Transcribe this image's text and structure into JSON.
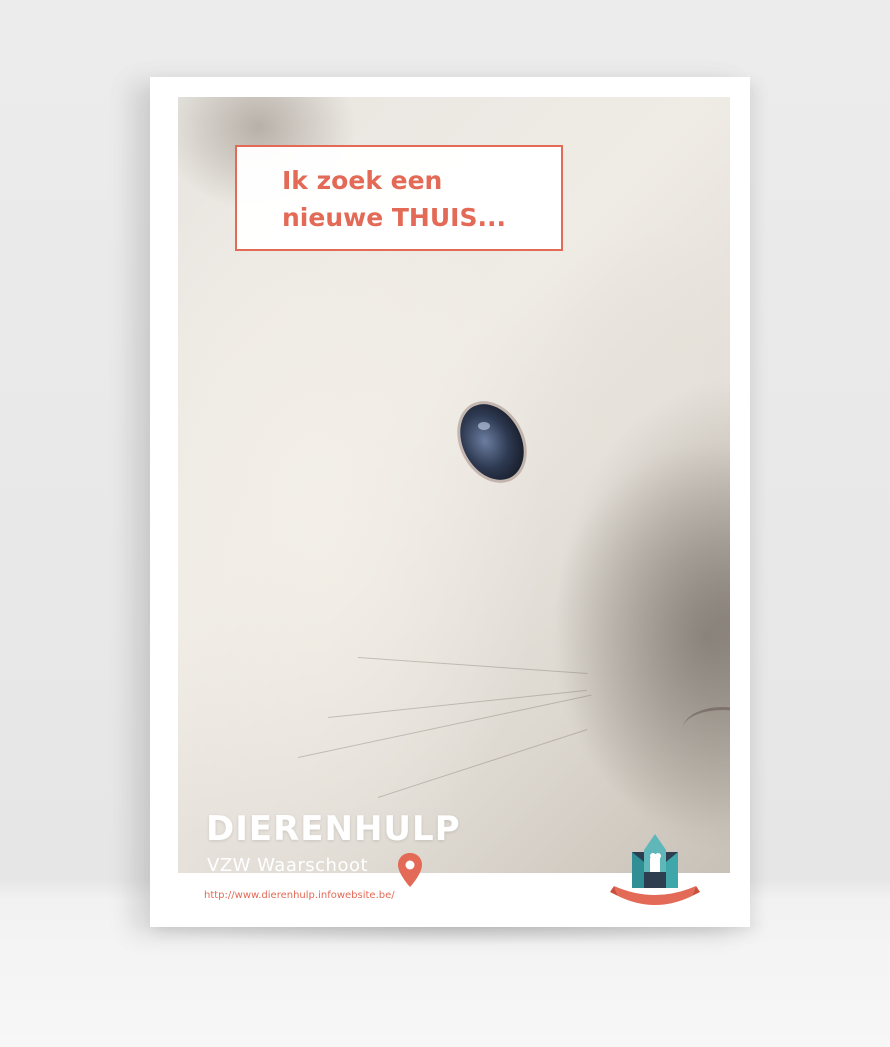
{
  "bubble": {
    "line1": "Ik zoek een",
    "line2": "nieuwe THUIS..."
  },
  "brand": {
    "title": "DIERENHULP",
    "subtitle": "VZW Waarschoot"
  },
  "footer": {
    "url": "http://www.dierenhulp.infowebsite.be/"
  },
  "logo": {
    "name": "DIERENHULP",
    "tag": "VZW"
  },
  "icons": {
    "location": "map-pin-icon"
  },
  "colors": {
    "accent": "#e36a56",
    "logo_teal": "#2f8f95",
    "logo_dark": "#2c3e50"
  }
}
